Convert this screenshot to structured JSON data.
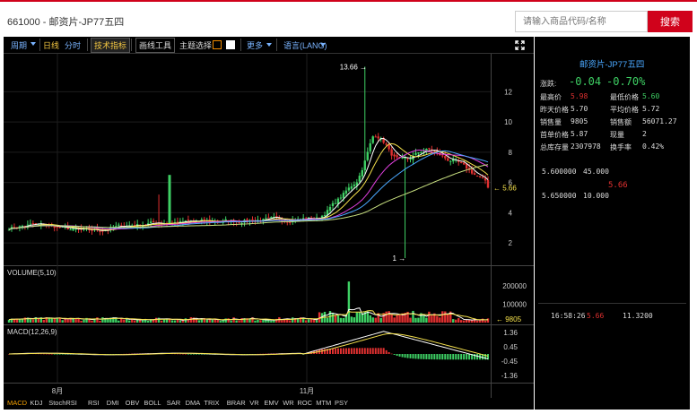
{
  "header": {
    "title": "661000 - 邮资片-JP77五四",
    "search_placeholder": "请输入商品代码/名称",
    "search_button": "搜索"
  },
  "toolbar": {
    "items": [
      "周期",
      "日线",
      "分时",
      "技术指标",
      "画线工具",
      "主题选择",
      "更多",
      "语言(LANG)"
    ]
  },
  "quote": {
    "name": "邮资片-JP77五四",
    "change_label": "涨跌:",
    "change": "-0.04",
    "change_pct": "-0.70%",
    "high_label": "最高价",
    "high": "5.98",
    "low_label": "最低价格",
    "low": "5.60",
    "prev_label": "昨天价格",
    "prev": "5.70",
    "avg_label": "平均价格",
    "avg": "5.72",
    "vol_label": "销售量",
    "vol": "9805",
    "amount_label": "销售额",
    "amount": "56071.27",
    "first_label": "首单价格",
    "first": "5.87",
    "cur_label": "现量",
    "cur": "2",
    "stock_label": "总库存量",
    "stock": "2307978",
    "turnover_label": "换手率",
    "turnover": "0.42%",
    "ask_price": "5.600000",
    "ask_vol": "45.000",
    "last_price": "5.66",
    "bid_price": "5.650000",
    "bid_vol": "10.000",
    "tick_time": "16:58:26",
    "tick_price": "5.66",
    "tick_vol": "11.3200"
  },
  "chart_data": {
    "type": "candlestick",
    "x_labels": [
      "8月",
      "11月"
    ],
    "price_ticks": [
      2,
      4,
      6,
      8,
      10,
      12
    ],
    "price_ylim": [
      1,
      13.8
    ],
    "max_label": "13.66",
    "min_label": "1",
    "last_label": "5.66",
    "volume_title": "VOLUME(5,10)",
    "volume_ticks": [
      100000,
      200000
    ],
    "volume_ticks_text": [
      "100000",
      "200000"
    ],
    "volume_last": "9805",
    "macd_title": "MACD(12,26,9)",
    "macd_ticks": [
      1.36,
      0.45,
      -0.45,
      -1.36
    ],
    "macd_ticks_text": [
      "1.36",
      "0.45",
      "-0.45",
      "-1.36"
    ],
    "colors": {
      "up": "#3ed064",
      "down": "#e03030",
      "ma1": "#ffffff",
      "ma2": "#f5e14c",
      "ma3": "#e040e0",
      "ma4": "#4aa8ff",
      "ma5": "#c8e080"
    }
  },
  "bottom_tabs": [
    "MACD",
    "KDJ",
    "StochRSI",
    "RSI",
    "DMI",
    "OBV",
    "BOLL",
    "SAR",
    "DMA",
    "TRIX",
    "BRAR",
    "VR",
    "EMV",
    "WR",
    "ROC",
    "MTM",
    "PSY"
  ]
}
